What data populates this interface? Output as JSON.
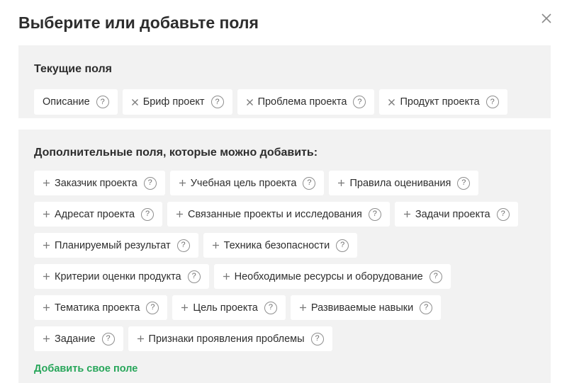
{
  "dialog": {
    "title": "Выберите или добавьте поля",
    "close_icon": "close-icon"
  },
  "current": {
    "title": "Текущие поля",
    "fields": [
      {
        "label": "Описание",
        "removable": false
      },
      {
        "label": "Бриф проект",
        "removable": true
      },
      {
        "label": "Проблема проекта",
        "removable": true
      },
      {
        "label": "Продукт проекта",
        "removable": true
      }
    ]
  },
  "extra": {
    "title": "Дополнительные поля, которые можно добавить:",
    "fields": [
      "Заказчик проекта",
      "Учебная цель проекта",
      "Правила оценивания",
      "Адресат проекта",
      "Связанные проекты и исследования",
      "Задачи проекта",
      "Планируемый результат",
      "Техника безопасности",
      "Критерии оценки продукта",
      "Необходимые ресурсы и оборудование",
      "Тематика проекта",
      "Цель проекта",
      "Развиваемые навыки",
      "Задание",
      "Признаки проявления проблемы"
    ],
    "add_own_label": "Добавить свое поле"
  },
  "help_symbol": "?",
  "colors": {
    "accent_green": "#27a65a",
    "section_bg": "#f2f2f2",
    "chip_bg": "#ffffff"
  }
}
